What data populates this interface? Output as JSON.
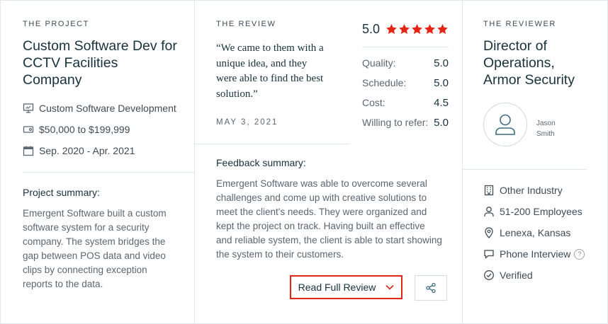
{
  "project": {
    "eyebrow": "THE PROJECT",
    "title_line1": "Custom Software Dev for",
    "title_line2": "CCTV Facilities",
    "title_line3": "Company",
    "service": "Custom Software Development",
    "budget": "$50,000 to $199,999",
    "timeline": "Sep. 2020 - Apr. 2021",
    "summary_label": "Project summary:",
    "summary_lines": [
      "Emergent Software built a custom",
      "software system for a security",
      "company. The system bridges the",
      "gap between POS data and video",
      "clips by connecting exception",
      "reports to the data."
    ]
  },
  "review": {
    "eyebrow": "THE REVIEW",
    "quote_lines": [
      "“We came to them with a",
      "unique idea, and they",
      "were able to find the best",
      "solution.”"
    ],
    "date": "MAY 3, 2021",
    "overall": "5.0",
    "stars": 5,
    "star_color": "#e62415",
    "scores": [
      {
        "label": "Quality:",
        "value": "5.0"
      },
      {
        "label": "Schedule:",
        "value": "5.0"
      },
      {
        "label": "Cost:",
        "value": "4.5"
      },
      {
        "label": "Willing to refer:",
        "value": "5.0"
      }
    ],
    "feedback_label": "Feedback summary:",
    "feedback_lines": [
      "Emergent Software was able to overcome several",
      "challenges and come up with creative solutions to",
      "meet the client's needs. They were organized and",
      "kept the project on track. Having built an effective",
      "and reliable system, the client is able to start showing",
      "the system to their customers."
    ],
    "read_full_label": "Read Full Review",
    "accent_color": "#e62415"
  },
  "reviewer": {
    "eyebrow": "THE REVIEWER",
    "title_line1": "Director of",
    "title_line2": "Operations,",
    "title_line3": "Armor Security",
    "first_name": "Jason",
    "last_name": "Smith",
    "industry": "Other Industry",
    "employees": "51-200 Employees",
    "location": "Lenexa, Kansas",
    "interview": "Phone Interview",
    "verified": "Verified"
  }
}
